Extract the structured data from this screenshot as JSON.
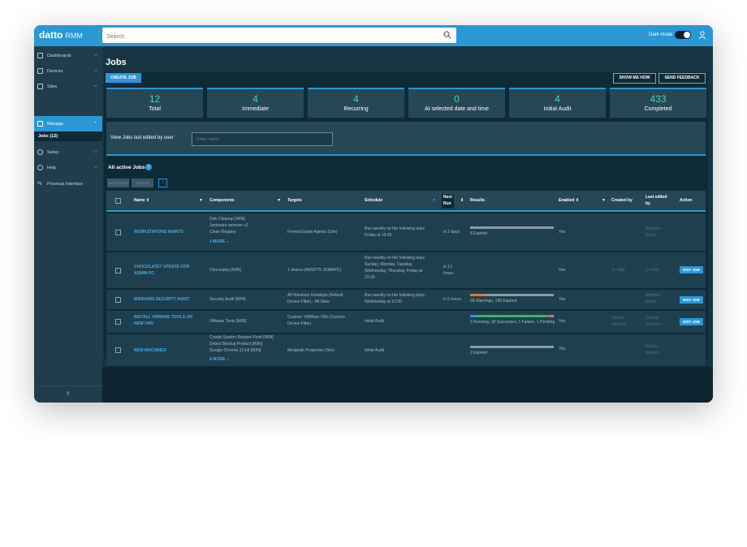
{
  "app": {
    "brand": "datto",
    "product": "RMM",
    "dark_mode_label": "Dark mode"
  },
  "search": {
    "placeholder": "Search"
  },
  "sidebar": {
    "items": [
      {
        "label": "Dashboards"
      },
      {
        "label": "Devices"
      },
      {
        "label": "Sites"
      },
      {
        "label": "Manage"
      },
      {
        "label": "Setup"
      },
      {
        "label": "Help"
      },
      {
        "label": "Previous Interface"
      }
    ],
    "sub_item": "Jobs (12)"
  },
  "page": {
    "title": "Jobs"
  },
  "toolbar": {
    "create_job": "CREATE JOB",
    "show_me_how": "SHOW ME HOW",
    "send_feedback": "SEND FEEDBACK"
  },
  "stats": [
    {
      "value": "12",
      "label": "Total"
    },
    {
      "value": "4",
      "label": "Immediate"
    },
    {
      "value": "4",
      "label": "Recurring"
    },
    {
      "value": "0",
      "label": "At selected date and time"
    },
    {
      "value": "4",
      "label": "Initial Audit"
    },
    {
      "value": "433",
      "label": "Completed"
    }
  ],
  "filter": {
    "label": "View Jobs last edited by user",
    "placeholder": "Enter name"
  },
  "table": {
    "title": "All active Jobs",
    "small_buttons": [
      "DEACTIVATE",
      "DELETE"
    ],
    "columns": [
      "Name",
      "Components",
      "Targets",
      "Schedule",
      "Next",
      "Run",
      "Results",
      "Enabled",
      "Created by",
      "Last edited",
      "by",
      "Action"
    ],
    "rows": [
      {
        "name": "WORKSTATIONS MAINTS",
        "components": [
          "Disk Cleanup [WIN]",
          "Junkware remover v2",
          "Clean Registry"
        ],
        "more": "1 MORE",
        "targets": [
          "Forrest Estate Agents (Site)"
        ],
        "schedule": [
          "Run weekly on the following days",
          "Friday at 19:00"
        ],
        "next_run": [
          "in 2 days"
        ],
        "results": "4 Expired",
        "enabled": "Yes",
        "created_by": "",
        "last_edited_by": [
          "Matthew",
          "Smith"
        ],
        "action": ""
      },
      {
        "name": "CHOCOLATEY UPDATE FOR",
        "name2": "ADMIN-PC",
        "components": [
          "Chocolatey [WIN]"
        ],
        "more": "",
        "targets": [
          "1 device (AMSPT5-JOMNPC)"
        ],
        "schedule": [
          "Run weekly on the following days",
          "Sunday, Monday, Tuesday,",
          "Wednesday, Thursday, Friday at",
          "23:20"
        ],
        "next_run": [
          "in 13",
          "hours"
        ],
        "results": "",
        "enabled": "Yes",
        "created_by": "Jo Wild",
        "last_edited_by": [
          "Jo Wild"
        ],
        "action": "EDIT JOB"
      },
      {
        "name": "WINDOWS SECURITY AUDIT",
        "components": [
          "Security Audit [WIN]"
        ],
        "more": "",
        "targets": [
          "All Windows Desktops (Default",
          "Device Filter) - All Sites"
        ],
        "schedule": [
          "Run weekly on the following days",
          "Wednesday at 12:00"
        ],
        "next_run": [
          "in 5 hours"
        ],
        "results": "59 Warnings, 186 Expired",
        "enabled": "Yes",
        "created_by": "",
        "last_edited_by": [
          "Matthew",
          "Smith"
        ],
        "action": "EDIT JOB"
      },
      {
        "name": "INSTALL VMWARE TOOLS ON",
        "name2": "NEW VMS",
        "components": [
          "VMware Tools [WIN]"
        ],
        "more": "",
        "targets": [
          "Custom: VMWare VMs (Custom",
          "Device Filter)"
        ],
        "schedule": [
          "Initial Audit"
        ],
        "next_run": [],
        "results": "2 Running, 18 Successes, 1 Failure, 1 Pending",
        "enabled": "Yes",
        "created_by": "George Harrison",
        "last_edited_by": [
          "George",
          "Harrison"
        ],
        "action": "EDIT JOB"
      },
      {
        "name": "NEW MACHINES",
        "components": [
          "Create System Restore Point [WIN]",
          "Detect Backup Product [WIN]",
          "Google Chrome 32-bit [WIN]"
        ],
        "more": "4 MORE",
        "targets": [
          "Medpeak Properties (Site)"
        ],
        "schedule": [
          "Initial Audit"
        ],
        "next_run": [],
        "results": "2 Expired",
        "enabled": "Yes",
        "created_by": "",
        "last_edited_by": [
          "Marian",
          "Watson"
        ],
        "action": ""
      }
    ]
  },
  "colors": {
    "accent": "#2b97d4",
    "teal": "#4ed0b4",
    "success": "#3bb26a",
    "warning": "#e07a2e",
    "failure": "#d9534f"
  }
}
